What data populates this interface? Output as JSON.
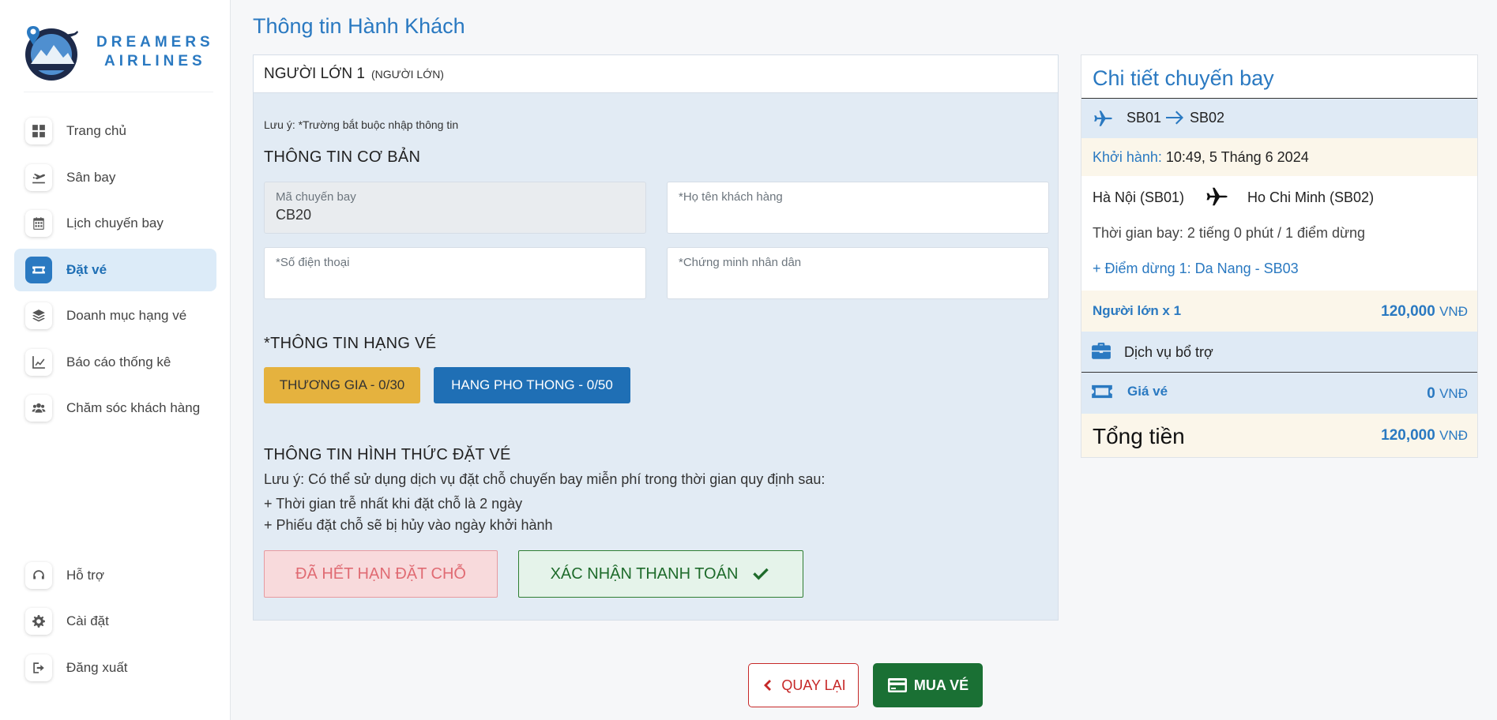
{
  "brand": {
    "line1": "DREAMERS",
    "line2": "AIRLINES"
  },
  "sidebar": {
    "items": [
      {
        "label": "Trang chủ",
        "icon": "windows-icon"
      },
      {
        "label": "Sân bay",
        "icon": "plane-departure-icon"
      },
      {
        "label": "Lịch chuyến bay",
        "icon": "calendar-icon"
      },
      {
        "label": "Đặt vé",
        "icon": "ticket-icon",
        "active": true
      },
      {
        "label": "Doanh mục hạng vé",
        "icon": "layers-icon"
      },
      {
        "label": "Báo cáo thống kê",
        "icon": "chart-line-icon"
      },
      {
        "label": "Chăm sóc khách hàng",
        "icon": "users-icon"
      }
    ],
    "bottom_items": [
      {
        "label": "Hỗ trợ",
        "icon": "headphones-icon"
      },
      {
        "label": "Cài đặt",
        "icon": "gear-icon"
      },
      {
        "label": "Đăng xuất",
        "icon": "logout-icon"
      }
    ]
  },
  "page": {
    "title": "Thông tin Hành Khách"
  },
  "passenger": {
    "header_main": "NGƯỜI LỚN 1",
    "header_sub": "(NGƯỜI LỚN)",
    "note": "Lưu ý: *Trường bắt buộc nhập thông tin",
    "basic_title": "THÔNG TIN CƠ BẢN",
    "fields": {
      "flight_code_label": "Mã chuyến bay",
      "flight_code_value": "CB20",
      "name_label": "*Họ tên khách hàng",
      "phone_label": "*Số điện thoại",
      "id_label": "*Chứng minh nhân dân"
    },
    "class_title": "*THÔNG TIN HẠNG VÉ",
    "class_business": "THƯƠNG GIA - 0/30",
    "class_economy": "HANG PHO THONG - 0/50",
    "booking_title": "THÔNG TIN HÌNH THỨC ĐẶT VÉ",
    "booking_note": "Lưu ý: Có thể sử dụng dịch vụ đặt chỗ chuyến bay miễn phí trong thời gian quy định sau:",
    "rule1": "+ Thời gian trễ nhất khi đặt chỗ là 2 ngày",
    "rule2": "+ Phiếu đặt chỗ sẽ bị hủy vào ngày khởi hành",
    "expired_label": "ĐÃ HẾT HẠN ĐẶT CHỖ",
    "confirm_label": "XÁC NHẬN THANH TOÁN"
  },
  "detail": {
    "title": "Chi tiết chuyến bay",
    "from_code": "SB01",
    "to_code": "SB02",
    "depart_label": "Khởi hành:",
    "depart_value": "10:49, 5 Tháng 6 2024",
    "from_city": "Hà Nội (SB01)",
    "to_city": "Ho Chi Minh (SB02)",
    "duration": "Thời gian bay: 2 tiếng 0 phút / 1 điểm dừng",
    "stop": "+ Điểm dừng 1: Da Nang - SB03",
    "adult_label": "Người lớn x 1",
    "adult_price": "120,000",
    "service_label": "Dịch vụ bổ trợ",
    "ticket_label": "Giá vé",
    "ticket_price": "0",
    "total_label": "Tổng tiền",
    "total_price": "120,000",
    "currency": "VNĐ"
  },
  "actions": {
    "back": "QUAY LẠI",
    "buy": "MUA VÉ"
  },
  "colors": {
    "primary": "#2a79c1",
    "gold": "#e5b23e",
    "green": "#1a7034",
    "red": "#c62828"
  }
}
